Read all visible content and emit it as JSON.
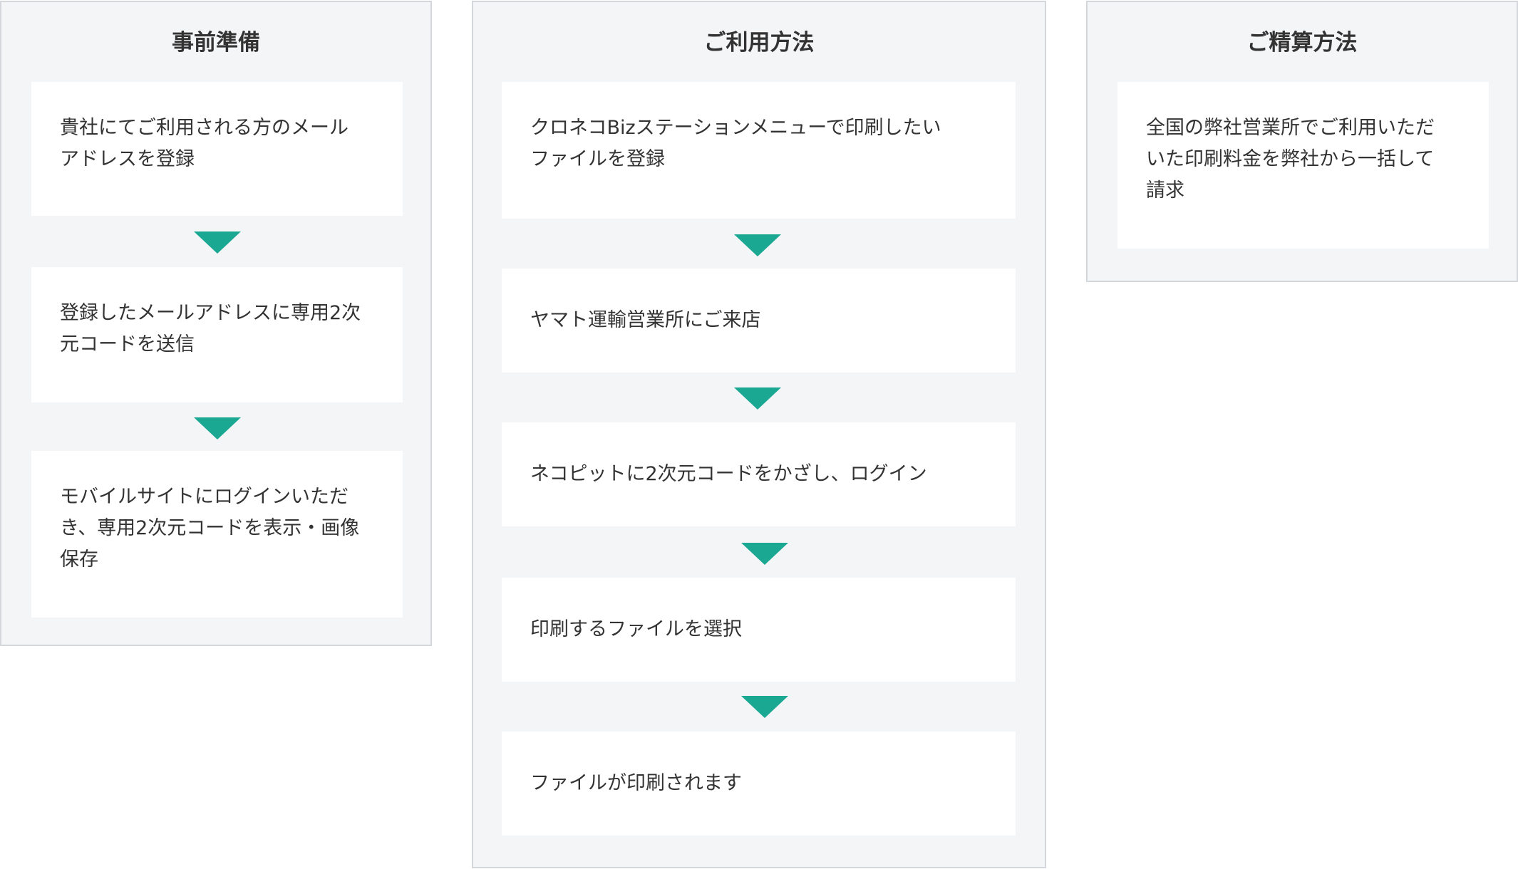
{
  "columns": [
    {
      "title": "事前準備",
      "steps": [
        "貴社にてご利用される方のメール\nアドレスを登録",
        "登録したメールアドレスに専用2次\n元コードを送信",
        "モバイルサイトにログインいただ\nき、専用2次元コードを表示・画像\n保存"
      ]
    },
    {
      "title": "ご利用方法",
      "steps": [
        "クロネコBizステーションメニューで印刷したい\nファイルを登録",
        "ヤマト運輸営業所にご来店",
        "ネコピットに2次元コードをかざし、ログイン",
        "印刷するファイルを選択",
        "ファイルが印刷されます"
      ]
    },
    {
      "title": "ご精算方法",
      "steps": [
        "全国の弊社営業所でご利用いただ\nいた印刷料金を弊社から一括して\n請求"
      ]
    }
  ],
  "colors": {
    "panel_background": "#f4f5f7",
    "panel_border": "#d4d7dc",
    "step_background": "#ffffff",
    "arrow": "#1aa893",
    "text": "#333333"
  },
  "icons": {
    "flow_arrow": "triangle-down"
  }
}
